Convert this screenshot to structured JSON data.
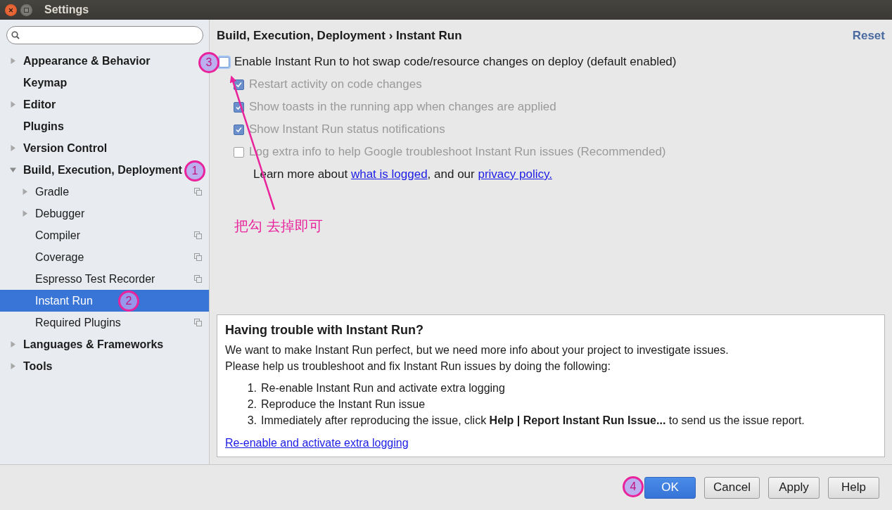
{
  "window": {
    "title": "Settings"
  },
  "sidebar": {
    "items": [
      {
        "label": "Appearance & Behavior",
        "expandable": true,
        "expanded": false,
        "selected": false,
        "project_level": false
      },
      {
        "label": "Keymap",
        "expandable": false,
        "selected": false,
        "project_level": false
      },
      {
        "label": "Editor",
        "expandable": true,
        "expanded": false,
        "selected": false,
        "project_level": false
      },
      {
        "label": "Plugins",
        "expandable": false,
        "selected": false,
        "project_level": false
      },
      {
        "label": "Version Control",
        "expandable": true,
        "expanded": false,
        "selected": false,
        "project_level": false
      },
      {
        "label": "Build, Execution, Deployment",
        "expandable": true,
        "expanded": true,
        "selected": false,
        "project_level": false,
        "children": [
          {
            "label": "Gradle",
            "expandable": true,
            "expanded": false,
            "selected": false,
            "project_level": true
          },
          {
            "label": "Debugger",
            "expandable": true,
            "expanded": false,
            "selected": false,
            "project_level": false
          },
          {
            "label": "Compiler",
            "expandable": false,
            "selected": false,
            "project_level": true
          },
          {
            "label": "Coverage",
            "expandable": false,
            "selected": false,
            "project_level": true
          },
          {
            "label": "Espresso Test Recorder",
            "expandable": false,
            "selected": false,
            "project_level": true
          },
          {
            "label": "Instant Run",
            "expandable": false,
            "selected": true,
            "project_level": false
          },
          {
            "label": "Required Plugins",
            "expandable": false,
            "selected": false,
            "project_level": true
          }
        ]
      },
      {
        "label": "Languages & Frameworks",
        "expandable": true,
        "expanded": false,
        "selected": false,
        "project_level": false
      },
      {
        "label": "Tools",
        "expandable": true,
        "expanded": false,
        "selected": false,
        "project_level": false
      }
    ]
  },
  "breadcrumb": "Build, Execution, Deployment › Instant Run",
  "reset": "Reset",
  "main_option": {
    "label": "Enable Instant Run to hot swap code/resource changes on deploy (default enabled)",
    "checked": false,
    "disabled": false
  },
  "sub_options": [
    {
      "label": "Restart activity on code changes",
      "checked": true,
      "disabled": true
    },
    {
      "label": "Show toasts in the running app when changes are applied",
      "checked": true,
      "disabled": true
    },
    {
      "label": "Show Instant Run status notifications",
      "checked": true,
      "disabled": true
    },
    {
      "label": "Log extra info to help Google troubleshoot Instant Run issues (Recommended)",
      "checked": false,
      "disabled": true
    }
  ],
  "learn_more": [
    {
      "kind": "text",
      "text": "Learn more about "
    },
    {
      "kind": "link",
      "text": "what is logged"
    },
    {
      "kind": "text",
      "text": ", and our "
    },
    {
      "kind": "link",
      "text": "privacy policy."
    }
  ],
  "help_box": {
    "title": "Having trouble with Instant Run?",
    "paragraphs": [
      "We want to make Instant Run perfect, but we need more info about your project to investigate issues.",
      "Please help us troubleshoot and fix Instant Run issues by doing the following:"
    ],
    "steps": [
      {
        "number": "1.",
        "text": "Re-enable Instant Run and activate extra logging"
      },
      {
        "number": "2.",
        "text": "Reproduce the Instant Run issue"
      },
      {
        "number": "3.",
        "text": "Immediately after reproducing the issue, click **Help | Report Instant Run Issue...** to send us the issue report."
      }
    ],
    "link": "Re-enable and activate extra logging"
  },
  "buttons": [
    {
      "label": "OK",
      "kind": "primary"
    },
    {
      "label": "Cancel",
      "kind": "normal"
    },
    {
      "label": "Apply",
      "kind": "normal"
    },
    {
      "label": "Help",
      "kind": "normal"
    }
  ],
  "annotations": {
    "markers": [
      "1",
      "2",
      "3",
      "4"
    ],
    "note": "把勾 去掉即可"
  }
}
